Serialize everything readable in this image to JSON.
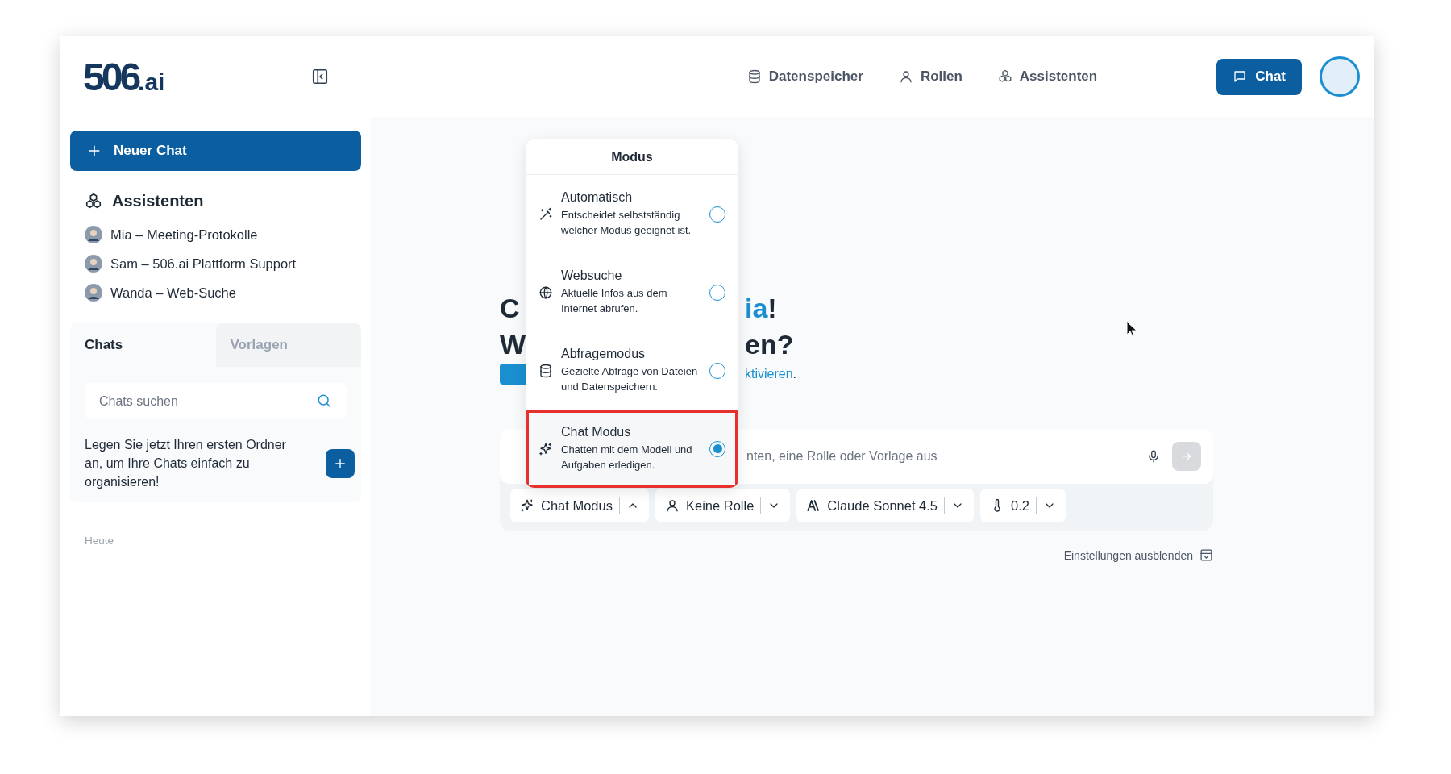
{
  "header": {
    "logo": {
      "main": "506",
      "suffix": ".ai"
    },
    "nav": [
      {
        "label": "Datenspeicher",
        "kind": "database"
      },
      {
        "label": "Rollen",
        "kind": "user"
      },
      {
        "label": "Assistenten",
        "kind": "cubes"
      }
    ],
    "chat_button": "Chat"
  },
  "sidebar": {
    "new_chat": "Neuer Chat",
    "assistants_title": "Assistenten",
    "assistants": [
      {
        "name": "Mia – Meeting-Protokolle"
      },
      {
        "name": "Sam – 506.ai Plattform Support"
      },
      {
        "name": "Wanda – Web-Suche"
      }
    ],
    "tabs": [
      {
        "label": "Chats",
        "selected": true
      },
      {
        "label": "Vorlagen",
        "selected": false
      }
    ],
    "search": {
      "placeholder": "Chats suchen"
    },
    "folder_hint": "Legen Sie jetzt Ihren ersten Ordner an, um Ihre Chats einfach zu organisieren!",
    "section": "Heute"
  },
  "main": {
    "greeting": [
      {
        "left": "C",
        "right": [
          {
            "text": "ia",
            "accent": true
          },
          {
            "text": "!",
            "accent": false
          }
        ]
      },
      {
        "left": "W",
        "right": [
          {
            "text": "en?",
            "accent": false
          }
        ]
      }
    ],
    "hint": {
      "link": "ktivieren",
      "tail": "."
    },
    "composer": {
      "placeholder": "nten, eine Rolle oder Vorlage aus"
    },
    "toolbar": [
      {
        "label": "Chat Modus",
        "kind": "sparkle",
        "expanded": true
      },
      {
        "label": "Keine Rolle",
        "kind": "user",
        "expanded": false
      },
      {
        "label": "Claude Sonnet 4.5",
        "kind": "anthropic",
        "expanded": false
      },
      {
        "label": "0.2",
        "kind": "thermometer",
        "expanded": false
      }
    ],
    "settings_toggle": "Einstellungen ausblenden"
  },
  "mode_menu": {
    "title": "Modus",
    "options": [
      {
        "title": "Automatisch",
        "description": "Entscheidet selbstständig welcher Modus geeignet ist.",
        "kind": "wand",
        "selected": false,
        "highlighted": false
      },
      {
        "title": "Websuche",
        "description": "Aktuelle Infos aus dem Internet abrufen.",
        "kind": "globe",
        "selected": false,
        "highlighted": false
      },
      {
        "title": "Abfragemodus",
        "description": "Gezielte Abfrage von Dateien und Datenspeichern.",
        "kind": "database",
        "selected": false,
        "highlighted": false
      },
      {
        "title": "Chat Modus",
        "description": "Chatten mit dem Modell und Aufgaben erledigen.",
        "kind": "sparkle",
        "selected": true,
        "highlighted": true
      }
    ]
  }
}
